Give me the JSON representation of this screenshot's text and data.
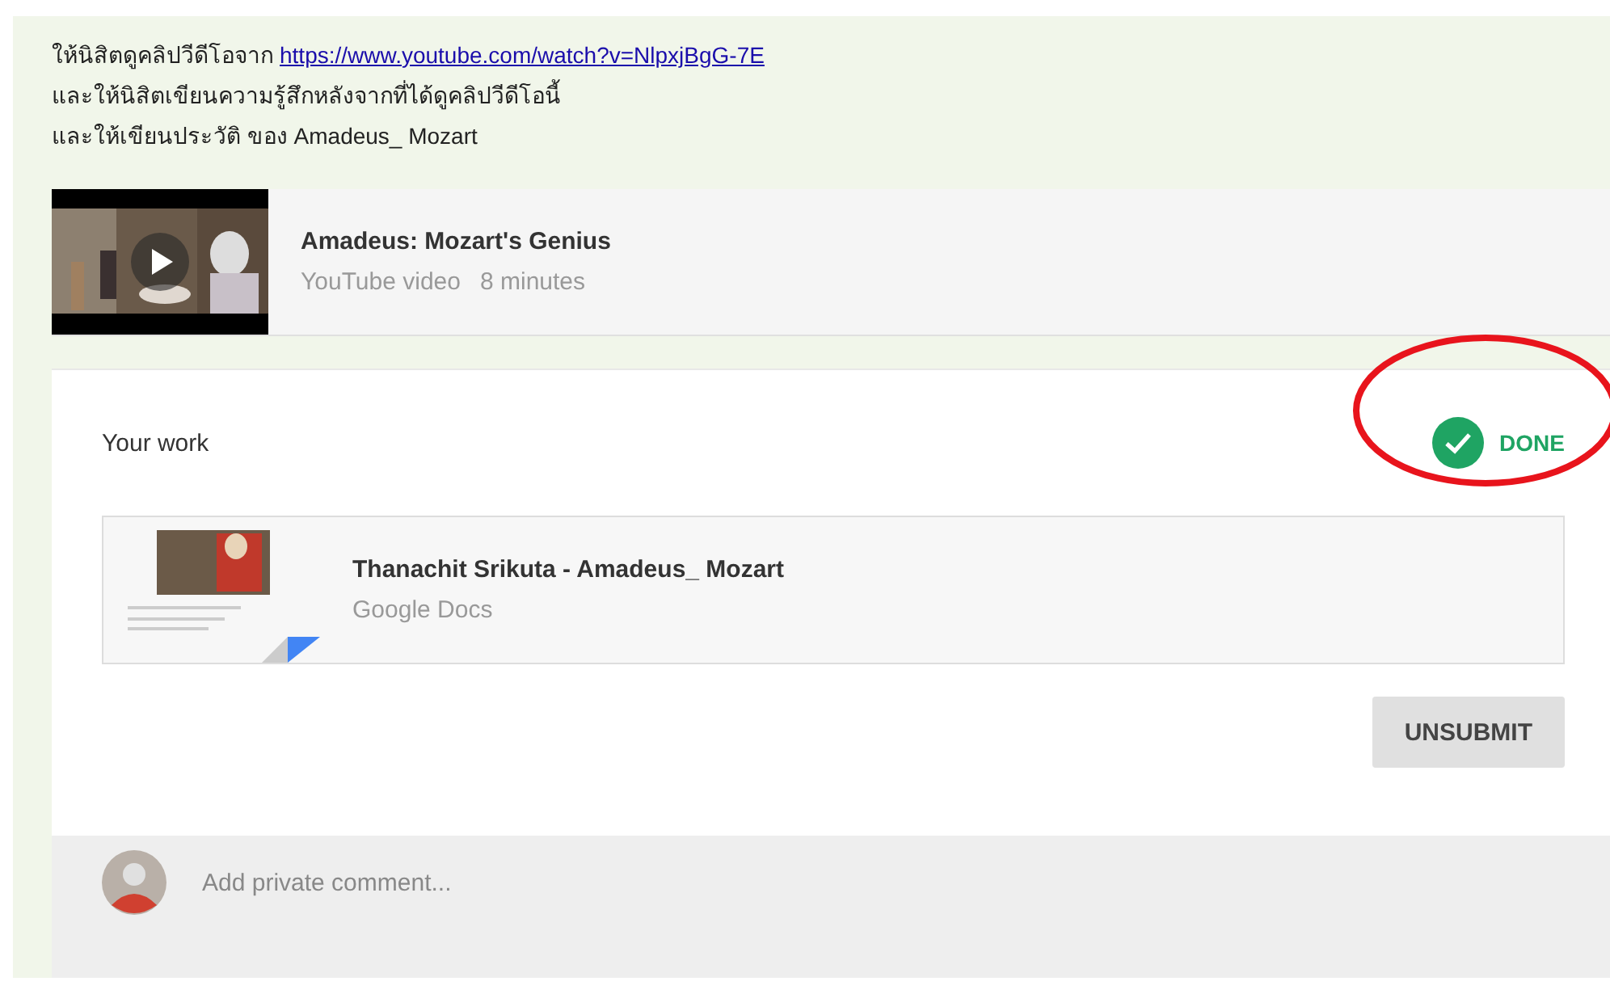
{
  "instructions": [
    {
      "text": "ให้นิสิตดูคลิปวีดีโอจาก",
      "link": "https://www.youtube.com/watch?v=NlpxjBgG-7E"
    },
    {
      "text": "และให้นิสิตเขียนความรู้สึกหลังจากที่ได้ดูคลิปวีดีโอนี้"
    },
    {
      "text": "และให้เขียนประวัติ ของ Amadeus_ Mozart"
    }
  ],
  "video": {
    "title": "Amadeus: Mozart's Genius",
    "source": "YouTube video",
    "duration": "8 minutes"
  },
  "your_work": {
    "heading": "Your work",
    "status": {
      "label": "DONE",
      "done": true,
      "circled": true
    },
    "file": {
      "title": "Thanachit Srikuta - Amadeus_ Mozart",
      "source": "Google Docs"
    },
    "button": "UNSUBMIT"
  },
  "comment": {
    "placeholder": "Add private comment..."
  }
}
